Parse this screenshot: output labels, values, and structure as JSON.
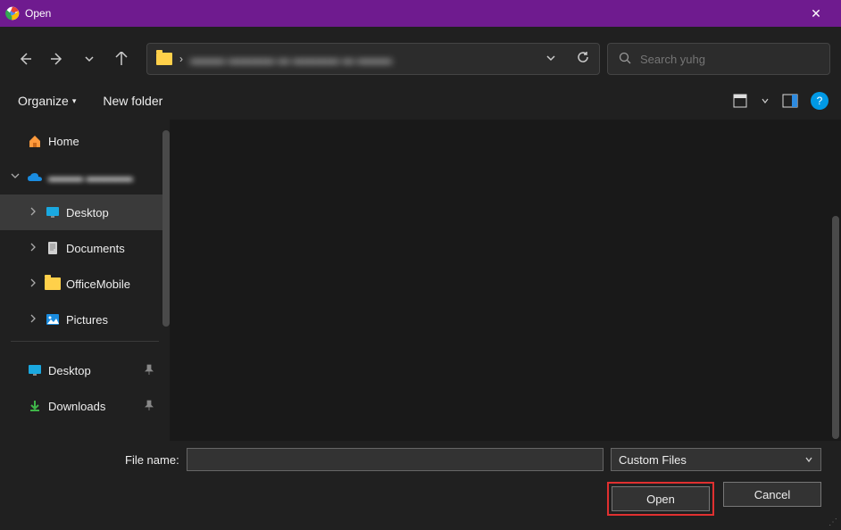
{
  "titlebar": {
    "title": "Open"
  },
  "addressbar": {
    "path_blurred": "▬▬▬ ▬▬▬▬ ▬ ▬▬▬▬ ▬ ▬▬▬"
  },
  "search": {
    "placeholder": "Search yuhg"
  },
  "toolbar": {
    "organize_label": "Organize",
    "newfolder_label": "New folder"
  },
  "sidebar": {
    "home": "Home",
    "cloud_blurred": "▬▬▬ ▬▬▬▬",
    "desktop": "Desktop",
    "documents": "Documents",
    "officemobile": "OfficeMobile",
    "pictures": "Pictures",
    "desktop2": "Desktop",
    "downloads": "Downloads"
  },
  "bottom": {
    "filename_label": "File name:",
    "filename_value": "",
    "filetype_label": "Custom Files",
    "open_label": "Open",
    "cancel_label": "Cancel"
  }
}
